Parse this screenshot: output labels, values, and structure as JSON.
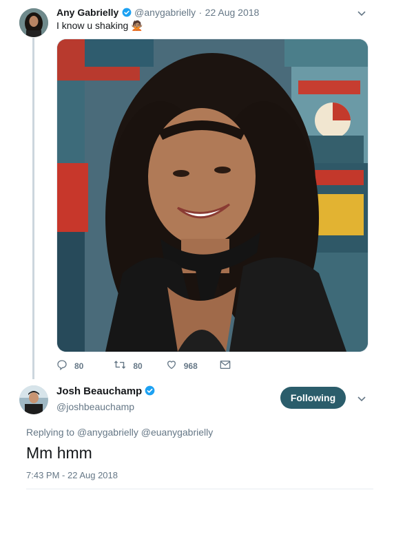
{
  "tweet1": {
    "name": "Any Gabrielly",
    "handle": "@anygabrielly",
    "date_separator": "·",
    "date": "22 Aug 2018",
    "text": "I know u shaking",
    "emoji": "🙅🏽",
    "stats": {
      "replies": "80",
      "retweets": "80",
      "likes": "968"
    }
  },
  "tweet2": {
    "name": "Josh Beauchamp",
    "handle": "@joshbeauchamp",
    "follow_label": "Following",
    "replying_prefix": "Replying to",
    "replying_to_1": "@anygabrielly",
    "replying_to_2": "@euanygabrielly",
    "text": "Mm hmm",
    "timestamp": "7:43 PM - 22 Aug 2018"
  },
  "colors": {
    "verified": "#1da1f2",
    "follow_bg": "#2b5d6b",
    "muted": "#657786"
  },
  "icons": [
    "verified-badge-icon",
    "chevron-down-icon",
    "reply-icon",
    "retweet-icon",
    "like-icon",
    "message-icon"
  ]
}
